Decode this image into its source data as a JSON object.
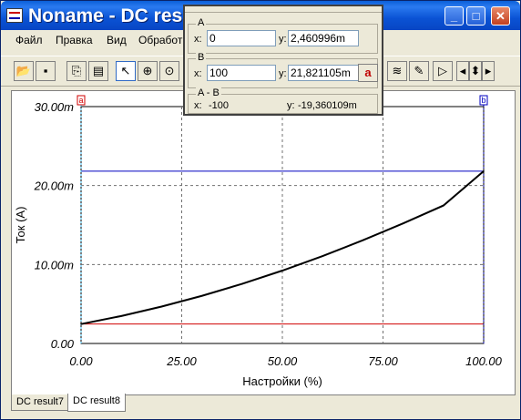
{
  "window": {
    "title": "Noname - DC result",
    "controls": {
      "minimize": "_",
      "maximize": "□",
      "close": "✕"
    }
  },
  "menu": [
    "Файл",
    "Правка",
    "Вид",
    "Обработ"
  ],
  "readout": {
    "a": {
      "title": "A",
      "x_label": "x:",
      "x_value": "0",
      "y_label": "y:",
      "y_value": "2,460996m"
    },
    "b": {
      "title": "B",
      "x_label": "x:",
      "x_value": "100",
      "y_label": "y:",
      "y_value": "21,821105m",
      "button_label": "a"
    },
    "diff": {
      "title": "A - B",
      "x_label": "x:",
      "x_value": "-100",
      "y_label": "y:",
      "y_value": "-19,360109m"
    }
  },
  "cursors": {
    "a_label": "a",
    "b_label": "b"
  },
  "tabs": [
    {
      "label": "DC result7",
      "active": false
    },
    {
      "label": "DC result8",
      "active": true
    }
  ],
  "colors": {
    "curve": "#000000",
    "cursor_a": "#40c0ff",
    "cursor_b": "#0000a0",
    "hline_a": "#d00000",
    "hline_b": "#0000c0",
    "grid": "#707070"
  },
  "chart_data": {
    "type": "line",
    "xlabel": "Настройки  (%)",
    "ylabel": "Ток (А)",
    "xlim": [
      0,
      100
    ],
    "ylim": [
      0,
      30
    ],
    "x_ticks": [
      "0.00",
      "25.00",
      "50.00",
      "75.00",
      "100.00"
    ],
    "y_ticks": [
      "0.00",
      "10.00m",
      "20.00m",
      "30.00m"
    ],
    "grid": true,
    "series": [
      {
        "x": [
          0,
          10,
          20,
          30,
          40,
          50,
          60,
          70,
          80,
          90,
          100
        ],
        "values": [
          2.46,
          3.48,
          4.67,
          6.03,
          7.55,
          9.23,
          11.07,
          13.07,
          15.21,
          17.47,
          21.82
        ]
      }
    ],
    "cursor_a": {
      "x": 0,
      "y": 2.460996
    },
    "cursor_b": {
      "x": 100,
      "y": 21.821105
    }
  }
}
